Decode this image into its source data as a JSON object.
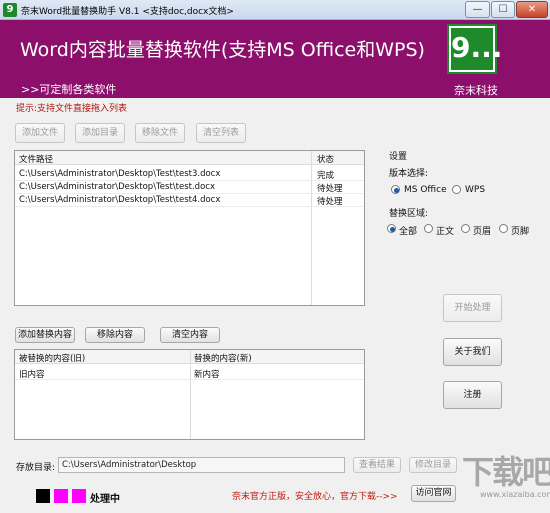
{
  "window": {
    "title": "奈末Word批量替换助手 V8.1  <支持doc,docx文档>",
    "icon_text": "9",
    "controls": {
      "minimize": "—",
      "maximize": "☐",
      "close": "✕"
    }
  },
  "banner": {
    "title": "Word内容批量替换软件(支持MS Office和WPS)",
    "subtitle": ">>可定制各类软件",
    "logo_text": "9...",
    "company": "奈末科技",
    "bg_color": "#8c0f6b"
  },
  "hint": "提示:支持文件直接拖入列表",
  "file_toolbar": {
    "add_file": "添加文件",
    "add_dir": "添加目录",
    "remove_file": "移除文件",
    "clear_list": "清空列表"
  },
  "file_table": {
    "headers": [
      "文件路径",
      "状态"
    ],
    "rows": [
      {
        "path": "C:\\Users\\Administrator\\Desktop\\Test\\test3.docx",
        "status": "完成"
      },
      {
        "path": "C:\\Users\\Administrator\\Desktop\\Test\\test.docx",
        "status": "待处理"
      },
      {
        "path": "C:\\Users\\Administrator\\Desktop\\Test\\test4.docx",
        "status": "待处理"
      }
    ]
  },
  "settings": {
    "title": "设置",
    "version_label": "版本选择:",
    "version_options": [
      "MS Office",
      "WPS"
    ],
    "version_selected": "MS Office",
    "range_label": "替换区域:",
    "range_options": [
      "全部",
      "正文",
      "页眉",
      "页脚"
    ],
    "range_selected": "全部"
  },
  "actions": {
    "start": "开始处理",
    "about": "关于我们",
    "register": "注册"
  },
  "replace_toolbar": {
    "add": "添加替换内容",
    "remove": "移除内容",
    "clear": "清空内容"
  },
  "replace_table": {
    "headers": [
      "被替换的内容(旧)",
      "替换的内容(新)"
    ],
    "rows": [
      {
        "old": "旧内容",
        "new": "新内容"
      }
    ]
  },
  "output": {
    "label": "存放目录:",
    "path": "C:\\Users\\Administrator\\Desktop",
    "view_result": "查看结果",
    "change_dir": "修改目录"
  },
  "status": {
    "swatches": [
      "#000000",
      "#ff00ff",
      "#ff00ff"
    ],
    "text": "处理中"
  },
  "footer": {
    "promo": "奈末官方正版，安全放心，官方下载-->>",
    "website": "访问官网"
  },
  "watermark": {
    "text": "下载吧",
    "sub": "www.xiazaiba.com"
  }
}
